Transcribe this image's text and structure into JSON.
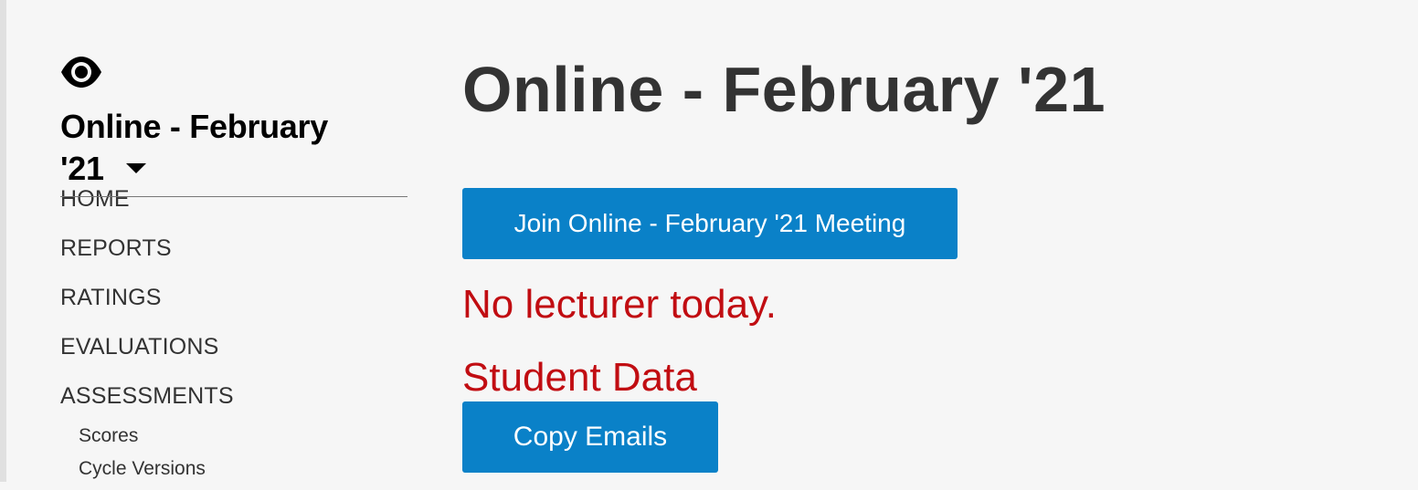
{
  "sidebar": {
    "visibility_icon": "eye-icon",
    "course_title": "Online - February '21",
    "dropdown_icon": "caret-down-icon",
    "nav_items": [
      {
        "label": "HOME"
      },
      {
        "label": "REPORTS"
      },
      {
        "label": "RATINGS"
      },
      {
        "label": "EVALUATIONS"
      },
      {
        "label": "ASSESSMENTS"
      }
    ],
    "sub_items": [
      {
        "label": "Scores"
      },
      {
        "label": "Cycle Versions"
      }
    ]
  },
  "main": {
    "title": "Online - February '21",
    "join_button_label": "Join Online - February '21 Meeting",
    "notice": "No lecturer today.",
    "section_heading": "Student Data",
    "copy_emails_label": "Copy Emails"
  },
  "colors": {
    "background": "#f6f6f6",
    "button": "#0a81c8",
    "alert_text": "#c10d12",
    "heading_text": "#333333"
  }
}
